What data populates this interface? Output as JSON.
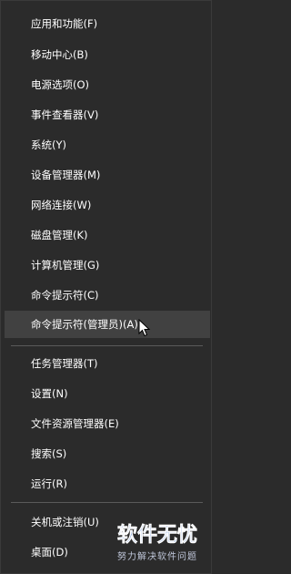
{
  "menu": {
    "items": [
      {
        "label": "应用和功能(F)"
      },
      {
        "label": "移动中心(B)"
      },
      {
        "label": "电源选项(O)"
      },
      {
        "label": "事件查看器(V)"
      },
      {
        "label": "系统(Y)"
      },
      {
        "label": "设备管理器(M)"
      },
      {
        "label": "网络连接(W)"
      },
      {
        "label": "磁盘管理(K)"
      },
      {
        "label": "计算机管理(G)"
      },
      {
        "label": "命令提示符(C)"
      },
      {
        "label": "命令提示符(管理员)(A)"
      },
      {
        "label": "任务管理器(T)"
      },
      {
        "label": "设置(N)"
      },
      {
        "label": "文件资源管理器(E)"
      },
      {
        "label": "搜索(S)"
      },
      {
        "label": "运行(R)"
      },
      {
        "label": "关机或注销(U)"
      },
      {
        "label": "桌面(D)"
      }
    ],
    "highlighted_item": "命令提示符(管理员)(A)"
  },
  "watermark": {
    "logo_text": "软件无忧",
    "subtitle": "努力解决软件问题",
    "color": "#4a78c6"
  }
}
